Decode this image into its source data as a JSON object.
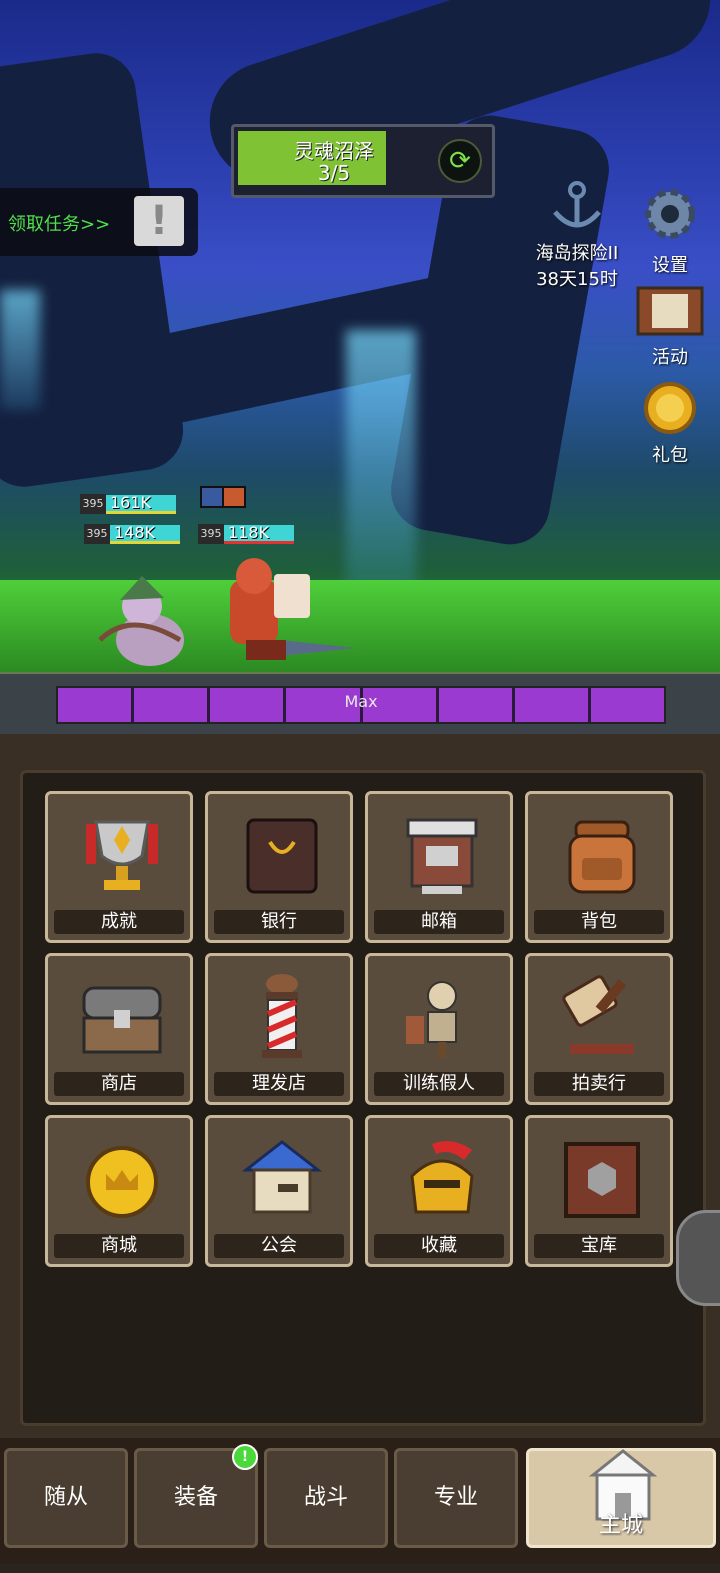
{
  "stage": {
    "name": "灵魂沼泽",
    "progress": "3/5",
    "progress_fraction": 0.6
  },
  "quest": {
    "label": "领取任务>>",
    "alert_glyph": "!"
  },
  "side_buttons": [
    {
      "name": "island",
      "line1": "海岛探险II",
      "line2": "38天15时"
    },
    {
      "name": "settings",
      "label": "设置"
    },
    {
      "name": "events",
      "label": "活动"
    },
    {
      "name": "gift",
      "label": "礼包"
    }
  ],
  "heroes": [
    {
      "level": "395",
      "hp": "161K"
    },
    {
      "level": "395",
      "hp": "148K"
    },
    {
      "level": "395",
      "hp": "118K"
    }
  ],
  "rage": {
    "label": "Max",
    "segments": 8,
    "level": 1.0
  },
  "buildings": [
    {
      "label": "成就",
      "icon": "trophy-icon"
    },
    {
      "label": "银行",
      "icon": "safe-icon"
    },
    {
      "label": "邮箱",
      "icon": "mailbox-icon"
    },
    {
      "label": "背包",
      "icon": "backpack-icon"
    },
    {
      "label": "商店",
      "icon": "chest-icon"
    },
    {
      "label": "理发店",
      "icon": "barber-pole-icon"
    },
    {
      "label": "训练假人",
      "icon": "dummy-icon"
    },
    {
      "label": "拍卖行",
      "icon": "gavel-icon"
    },
    {
      "label": "商城",
      "icon": "crown-coin-icon"
    },
    {
      "label": "公会",
      "icon": "guild-house-icon"
    },
    {
      "label": "收藏",
      "icon": "helmet-icon"
    },
    {
      "label": "宝库",
      "icon": "vault-icon"
    }
  ],
  "nav": [
    {
      "label": "随从"
    },
    {
      "label": "装备",
      "badge": "!"
    },
    {
      "label": "战斗"
    },
    {
      "label": "专业"
    },
    {
      "label": "主城",
      "active": true
    }
  ],
  "colors": {
    "progress": "#7fc234",
    "rage": "#9b3ad0",
    "hp": "#3fd5d5",
    "quest_text": "#4fe04a"
  }
}
